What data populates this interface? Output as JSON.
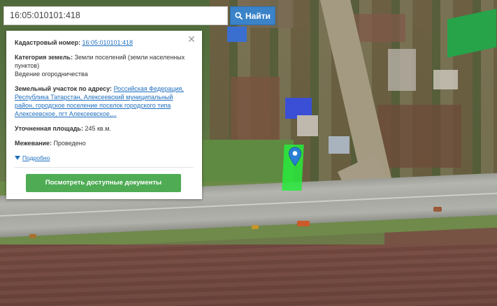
{
  "search": {
    "value": "16:05:010101:418",
    "button_label": "Найти",
    "button_icon": "search-icon"
  },
  "popup": {
    "close_icon": "close-icon",
    "cadastral_label": "Кадастровый номер:",
    "cadastral_value": "16:05:010101:418",
    "category_label": "Категория земель:",
    "category_value": "Земли поселений (земли населенных пунктов)",
    "category_use": "Ведение огородничества",
    "address_label": "Земельный участок по адресу:",
    "address_value": "Российская Федерация, Республика Татарстан, Алексеевский муниципальный район, городское поселение поселок городского типа Алексеевское, пгт Алексеевское,...",
    "area_label": "Уточненная площадь:",
    "area_value": "245 кв.м.",
    "survey_label": "Межевание:",
    "survey_value": "Проведено",
    "more_label": "Подробно",
    "docs_button_label": "Посмотреть доступные документы"
  },
  "colors": {
    "search_button": "#3a83c8",
    "docs_button": "#4fac55",
    "parcel_highlight": "#28eb3c",
    "link": "#1f6fbf",
    "marker": "#2a7fd4"
  },
  "map": {
    "marker_icon": "map-pin-icon"
  }
}
